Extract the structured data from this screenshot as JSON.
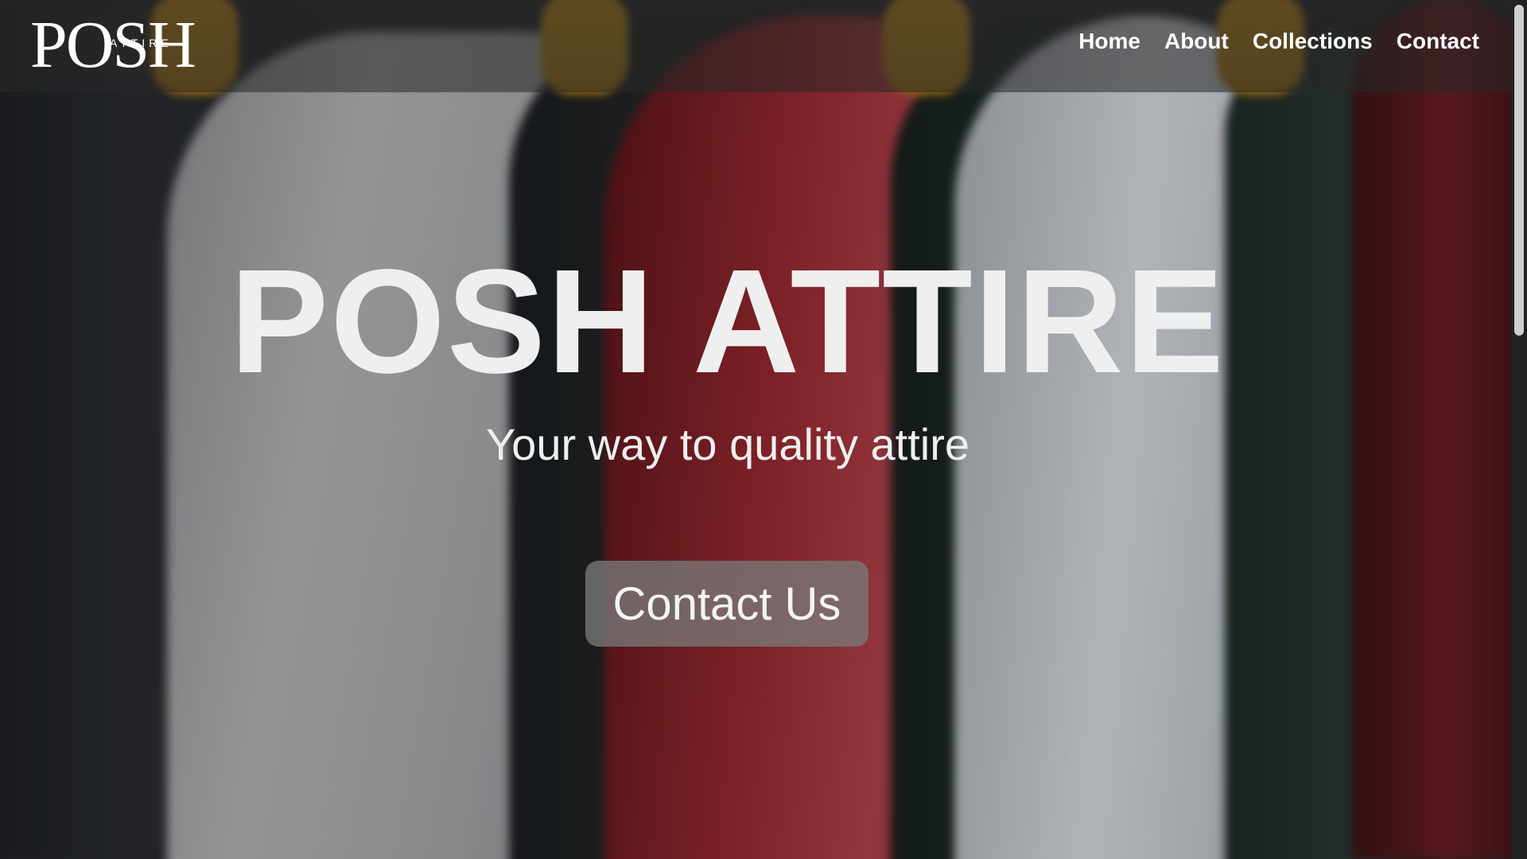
{
  "navbar": {
    "logo": {
      "wordmark": "POSH",
      "sub": "ATTIRE"
    },
    "links": [
      {
        "label": "Home"
      },
      {
        "label": "About"
      },
      {
        "label": "Collections"
      },
      {
        "label": "Contact"
      }
    ]
  },
  "hero": {
    "title": "POSH ATTIRE",
    "subtitle": "Your way to quality attire",
    "cta_label": "Contact Us",
    "background_image": "blurred-hoodies-on-rack"
  },
  "colors": {
    "navbar_bg": "#282828",
    "text": "#efefef",
    "button_bg": "#787878"
  }
}
